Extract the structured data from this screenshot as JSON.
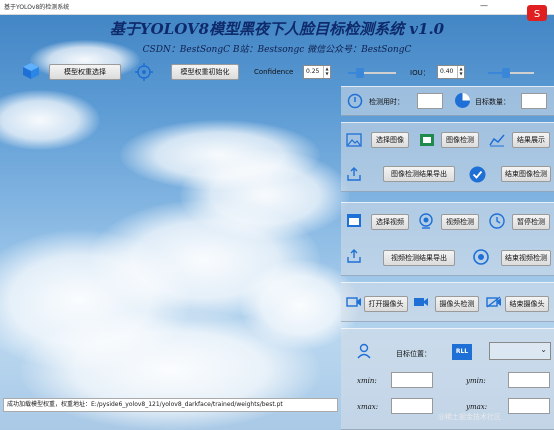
{
  "window": {
    "title": "基于YOLOv8的检测系统",
    "min_glyph": "—"
  },
  "header": {
    "title": "基于YOLOV8模型黑夜下人脸目标检测系统 v1.0",
    "subtitle": "CSDN：BestSongC   B站：Bestsongc   微信公众号：BestSongC"
  },
  "toolbar": {
    "select_model": "模型权重选择",
    "init_model": "模型权重初始化",
    "confidence_label": "Confidence",
    "confidence_value": "0.25",
    "confidence_level": 0.25,
    "iou_label": "IOU：",
    "iou_value": "0.40",
    "iou_level": 0.4
  },
  "stats": {
    "time_label": "检测用时：",
    "time_value": "",
    "count_label": "目标数量：",
    "count_value": ""
  },
  "image_section": {
    "select": "选择图像",
    "detect": "图像检测",
    "show": "结果展示",
    "export": "图像检测结果导出",
    "end": "结束图像检测"
  },
  "video_section": {
    "select": "选择视频",
    "detect": "视频检测",
    "pause": "暂停检测",
    "export": "视频检测结果导出",
    "end": "结束视频检测"
  },
  "camera_section": {
    "open": "打开摄像头",
    "detect": "摄像头检测",
    "end": "结束摄像头"
  },
  "position_section": {
    "label": "目标位置：",
    "badge": "RLL",
    "xmin": "xmin:",
    "ymin": "ymin:",
    "xmax": "xmax:",
    "ymax": "ymax:"
  },
  "status_bar": {
    "text": "成功加载模型权重，权重地址：E:/pyside6_yolov8_121/yolov8_darkface/trained/weights/best.pt"
  },
  "watermark": "@稀土掘金技术社区",
  "colors": {
    "accent_blue": "#1e6fd6",
    "title_navy": "#0f2a6b",
    "slider_blue": "#3a86d8",
    "logo_red": "#e02020"
  }
}
